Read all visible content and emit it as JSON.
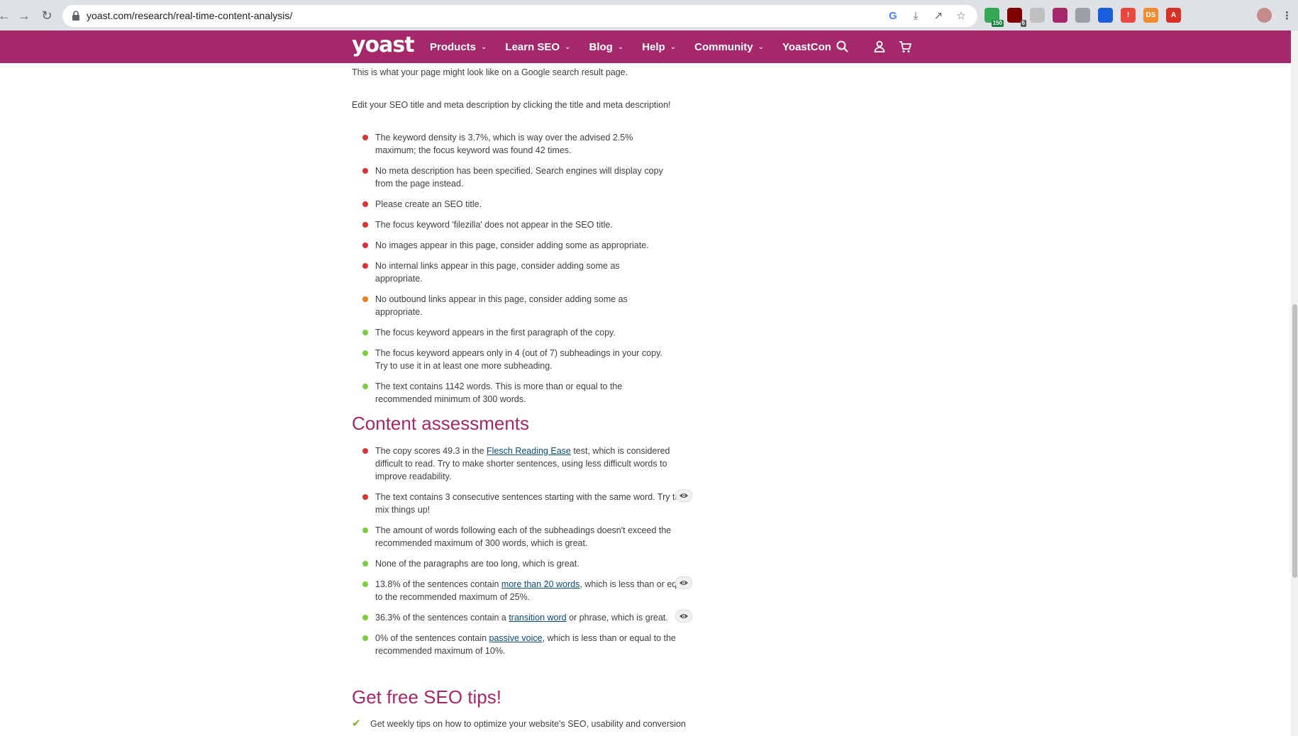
{
  "browser": {
    "url": "yoast.com/research/real-time-content-analysis/",
    "extensions": [
      {
        "name": "timer-extension-icon",
        "color": "#34a853",
        "badge": "150",
        "badge_color": "#188038"
      },
      {
        "name": "ublock-extension-icon",
        "color": "#800000",
        "badge": "6",
        "badge_color": "#555555"
      },
      {
        "name": "glasses-extension-icon",
        "color": "#bfbfbf",
        "badge": "",
        "badge_color": ""
      },
      {
        "name": "ball-extension-icon",
        "color": "#a4286a",
        "badge": "",
        "badge_color": ""
      },
      {
        "name": "hook-extension-icon",
        "color": "#9aa0a6",
        "badge": "",
        "badge_color": ""
      },
      {
        "name": "shield-extension-icon",
        "color": "#175ddc",
        "badge": "",
        "badge_color": ""
      },
      {
        "name": "red-box-extension-icon",
        "color": "#e8473f",
        "badge": "",
        "badge_color": ""
      },
      {
        "name": "ds-extension-icon",
        "color": "#f28b30",
        "badge": "",
        "badge_color": ""
      },
      {
        "name": "acrobat-extension-icon",
        "color": "#d93025",
        "badge": "",
        "badge_color": ""
      },
      {
        "name": "puzzle-extensions-icon",
        "color": "#5f6368",
        "badge": "",
        "badge_color": ""
      },
      {
        "name": "reading-list-icon",
        "color": "#5f6368",
        "badge": "",
        "badge_color": ""
      },
      {
        "name": "side-panel-icon",
        "color": "#5f6368",
        "badge": "",
        "badge_color": ""
      },
      {
        "name": "profile-avatar-icon",
        "color": "#c58a8a",
        "badge": "",
        "badge_color": ""
      },
      {
        "name": "browser-menu-icon",
        "color": "#5f6368",
        "badge": "",
        "badge_color": ""
      }
    ],
    "ext_labels": [
      "",
      "",
      "",
      "",
      "",
      "",
      "!",
      "DS",
      "A",
      "",
      "",
      "",
      "",
      "⋮"
    ]
  },
  "header": {
    "logo": "yoast",
    "menu": [
      "Products",
      "Learn SEO",
      "Blog",
      "Help",
      "Community",
      "YoastCon"
    ],
    "brand_color": "#a4286a"
  },
  "intro": {
    "snippet_text": "This is what your page might look like on a Google search result page.",
    "edit_text": "Edit your SEO title and meta description by clicking the title and meta description!"
  },
  "seo_assessments": [
    {
      "status": "bad",
      "lines": [
        "The keyword density is 3.7%, which is way over the advised 2.5%",
        "maximum; the focus keyword was found 42 times."
      ]
    },
    {
      "status": "bad",
      "lines": [
        "No meta description has been specified. Search engines will display copy",
        "from the page instead."
      ]
    },
    {
      "status": "bad",
      "lines": [
        "Please create an SEO title."
      ]
    },
    {
      "status": "bad",
      "lines": [
        "The focus keyword 'filezilla' does not appear in the SEO title."
      ]
    },
    {
      "status": "bad",
      "lines": [
        "No images appear in this page, consider adding some as appropriate."
      ]
    },
    {
      "status": "bad",
      "lines": [
        "No internal links appear in this page, consider adding some as",
        "appropriate."
      ]
    },
    {
      "status": "ok",
      "lines": [
        "No outbound links appear in this page, consider adding some as",
        "appropriate."
      ]
    },
    {
      "status": "good",
      "lines": [
        "The focus keyword appears in the first paragraph of the copy."
      ]
    },
    {
      "status": "good",
      "lines": [
        "The focus keyword appears only in 4 (out of 7) subheadings in your copy.",
        "Try to use it in at least one more subheading."
      ]
    },
    {
      "status": "good",
      "lines": [
        "The text contains 1142 words. This is more than or equal to the",
        "recommended minimum of 300 words."
      ]
    }
  ],
  "content_heading": "Content assessments",
  "content_assessments": [
    {
      "status": "bad",
      "parts": [
        "The copy scores 49.3 in the ",
        "Flesch Reading Ease",
        " test, which is considered difficult to read. Try to make shorter sentences, using less difficult words to improve readability."
      ],
      "eye": false
    },
    {
      "status": "bad",
      "parts": [
        "The text contains 3 consecutive sentences starting with the same word. Try to mix things up!",
        "",
        ""
      ],
      "eye": true
    },
    {
      "status": "good",
      "parts": [
        "The amount of words following each of the subheadings doesn't exceed the recommended maximum of 300 words, which is great.",
        "",
        ""
      ],
      "eye": false
    },
    {
      "status": "good",
      "parts": [
        "None of the paragraphs are too long, which is great.",
        "",
        ""
      ],
      "eye": false
    },
    {
      "status": "good",
      "parts": [
        "13.8% of the sentences contain ",
        "more than 20 words",
        ", which is less than or equal to the recommended maximum of 25%."
      ],
      "eye": true
    },
    {
      "status": "good",
      "parts": [
        "36.3% of the sentences contain a ",
        "transition word",
        " or phrase, which is great."
      ],
      "eye": true
    },
    {
      "status": "good",
      "parts": [
        "0% of the sentences contain ",
        "passive voice",
        ", which is less than or equal to the recommended maximum of 10%."
      ],
      "eye": false
    }
  ],
  "status_colors": {
    "bad": "#dc3232",
    "ok": "#ee7c1b",
    "good": "#7ad03a"
  },
  "tips_heading": "Get free SEO tips!",
  "tips": [
    "Get weekly tips on how to optimize your website's SEO, usability and conversion"
  ]
}
